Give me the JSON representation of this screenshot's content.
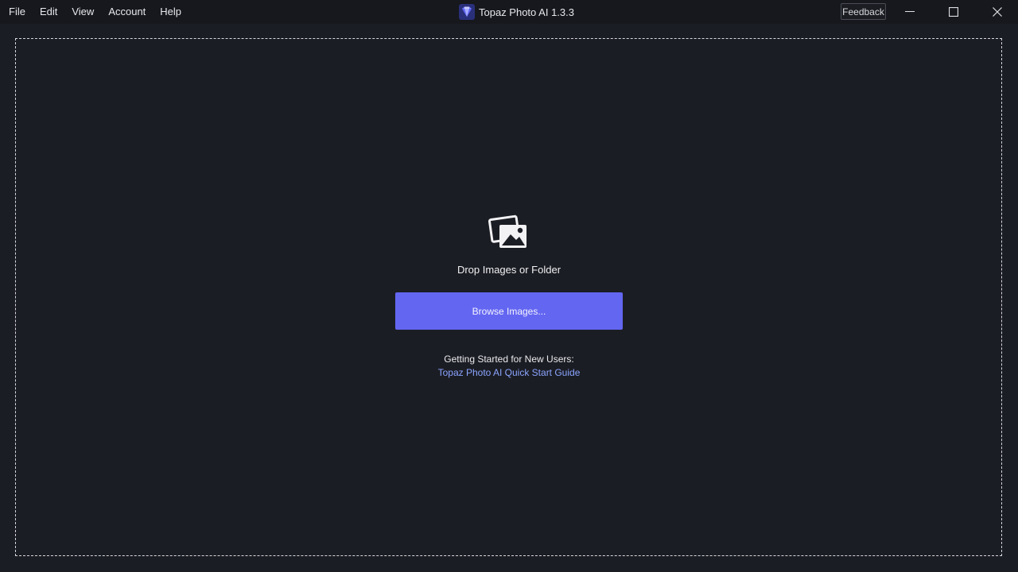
{
  "menu": {
    "items": [
      "File",
      "Edit",
      "View",
      "Account",
      "Help"
    ]
  },
  "app": {
    "title": "Topaz Photo AI 1.3.3",
    "logo_icon": "topaz-gem-logo"
  },
  "titlebar": {
    "feedback_label": "Feedback",
    "window_controls": [
      "minimize-icon",
      "maximize-icon",
      "close-icon"
    ]
  },
  "dropzone": {
    "icon": "images-icon",
    "text": "Drop Images or Folder",
    "browse_label": "Browse Images...",
    "getting_started": "Getting Started for New Users:",
    "guide_link": "Topaz Photo AI Quick Start Guide"
  },
  "colors": {
    "background": "#1b1d24",
    "titlebar": "#16181d",
    "accent": "#6366f1",
    "link": "#8aa4ff"
  }
}
